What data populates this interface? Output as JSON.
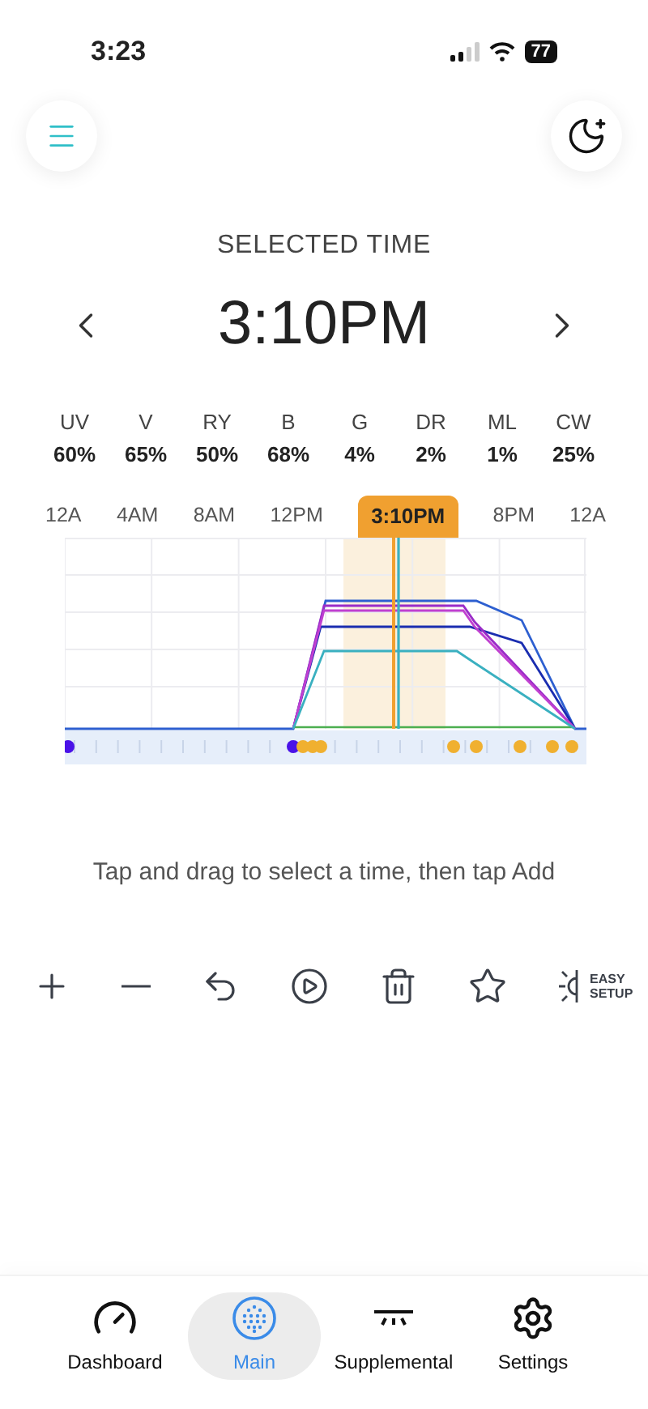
{
  "status_bar": {
    "time": "3:23",
    "battery": "77"
  },
  "heading": "SELECTED TIME",
  "selected_time": "3:10PM",
  "channels": [
    {
      "name": "UV",
      "value": "60%"
    },
    {
      "name": "V",
      "value": "65%"
    },
    {
      "name": "RY",
      "value": "50%"
    },
    {
      "name": "B",
      "value": "68%"
    },
    {
      "name": "G",
      "value": "4%"
    },
    {
      "name": "DR",
      "value": "2%"
    },
    {
      "name": "ML",
      "value": "1%"
    },
    {
      "name": "CW",
      "value": "25%"
    }
  ],
  "time_axis": [
    {
      "kind": "label",
      "label": "12A"
    },
    {
      "kind": "label",
      "label": "4AM"
    },
    {
      "kind": "label",
      "label": "8AM"
    },
    {
      "kind": "label",
      "label": "12PM"
    },
    {
      "kind": "marker",
      "label": "3:10PM"
    },
    {
      "kind": "label",
      "label": "8PM"
    },
    {
      "kind": "label",
      "label": "12A"
    }
  ],
  "hint": "Tap and drag to select a time, then tap Add",
  "toolbar": [
    {
      "kind": "add"
    },
    {
      "kind": "remove"
    },
    {
      "kind": "undo"
    },
    {
      "kind": "play"
    },
    {
      "kind": "delete"
    },
    {
      "kind": "favorite"
    },
    {
      "kind": "easy",
      "label": "EASY SETUP"
    }
  ],
  "tabs": [
    {
      "kind": "dashboard",
      "label": "Dashboard",
      "selected": false
    },
    {
      "kind": "main",
      "label": "Main",
      "selected": true
    },
    {
      "kind": "supplemental",
      "label": "Supplemental",
      "selected": false
    },
    {
      "kind": "settings",
      "label": "Settings",
      "selected": false
    }
  ]
}
